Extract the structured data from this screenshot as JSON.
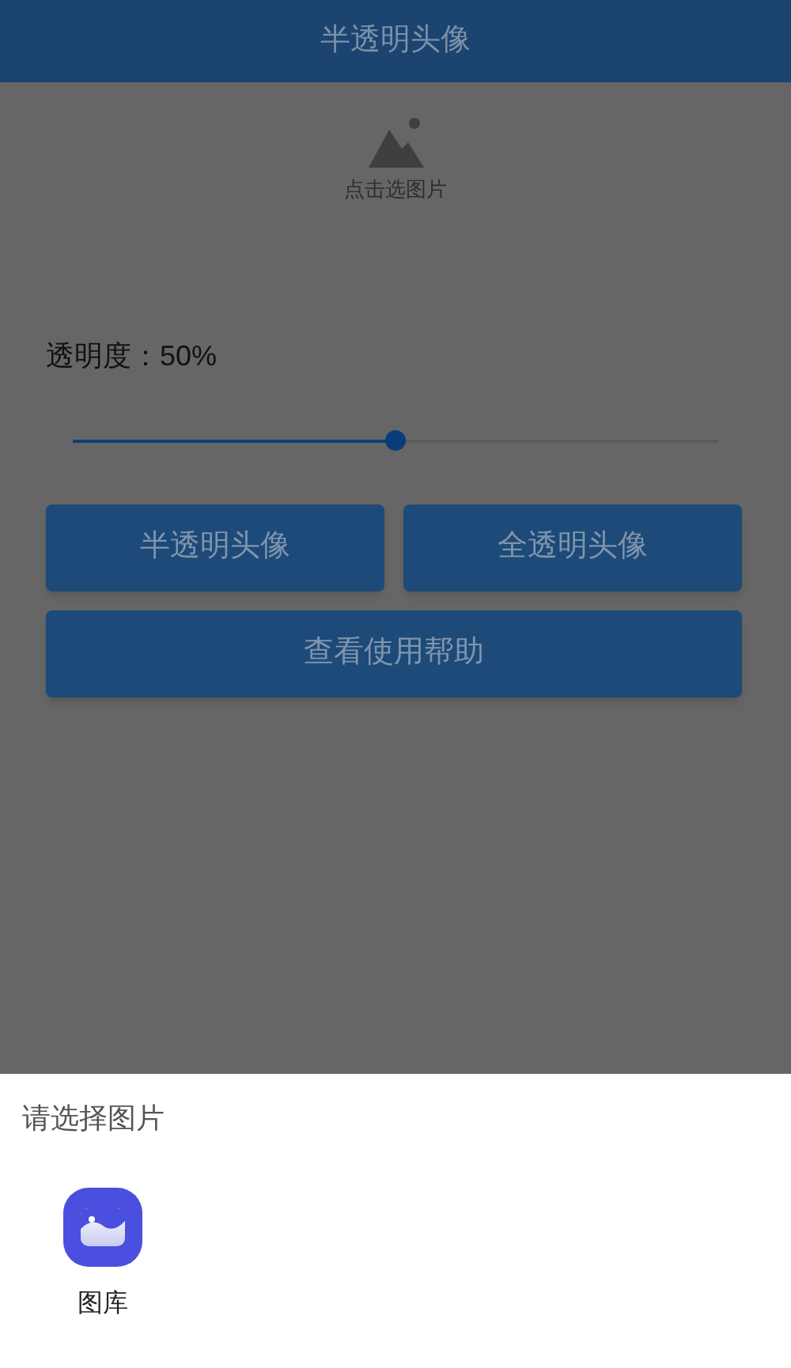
{
  "app_bar": {
    "title": "半透明头像"
  },
  "image_picker": {
    "label": "点击选图片"
  },
  "opacity": {
    "label": "透明度：50%",
    "level": 0.5
  },
  "buttons": [
    "半透明头像",
    "全透明头像",
    "查看使用帮助"
  ],
  "sheet": {
    "title": "请选择图片",
    "apps": [
      {
        "label": "图库"
      }
    ]
  }
}
